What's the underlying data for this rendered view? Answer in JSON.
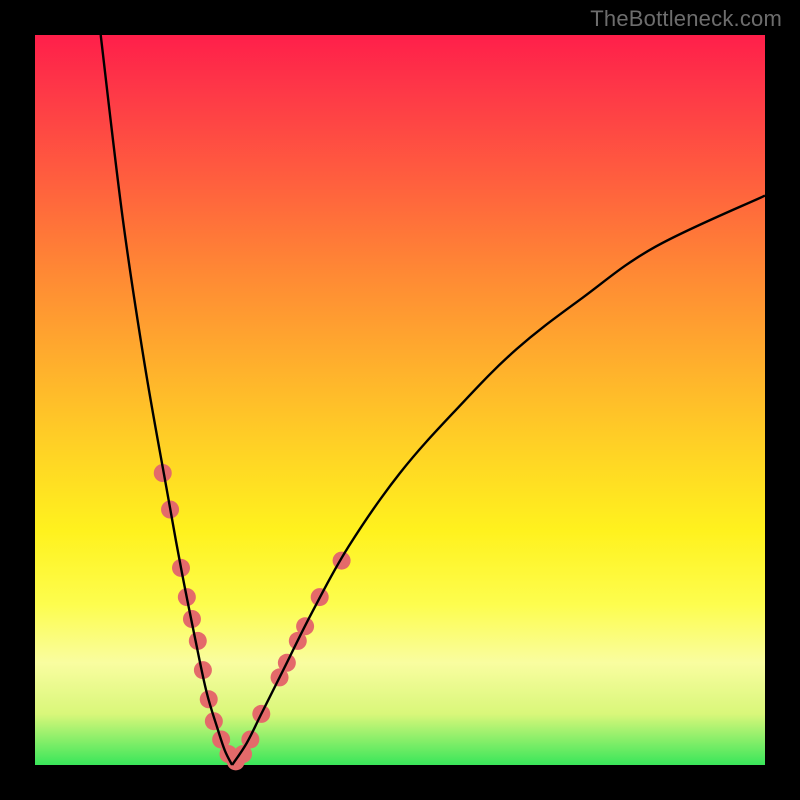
{
  "watermark": "TheBottleneck.com",
  "colors": {
    "frame": "#000000",
    "curve": "#000000",
    "dot_fill": "#e46a6a",
    "dot_stroke": "#c94f4f",
    "gradient_top": "#ff1f4a",
    "gradient_bottom": "#39e65a"
  },
  "chart_data": {
    "type": "line",
    "title": "",
    "xlabel": "",
    "ylabel": "",
    "xlim": [
      0,
      100
    ],
    "ylim": [
      0,
      100
    ],
    "description": "V-shaped bottleneck curve on red-to-green heat gradient. Minimum (0% bottleneck) near x≈27. Left branch rises very steeply to 100% at x≈9; right branch rises more gradually toward ~78% at x=100. Salmon dots cluster near the minimum on both branches.",
    "series": [
      {
        "name": "left-branch",
        "x": [
          9.0,
          12.0,
          15.0,
          18.0,
          20.0,
          22.0,
          23.5,
          25.0,
          26.0,
          27.0
        ],
        "values": [
          100,
          75,
          55,
          38,
          27,
          17,
          10,
          5,
          2,
          0
        ]
      },
      {
        "name": "right-branch",
        "x": [
          27.0,
          29.0,
          31.0,
          34.0,
          38.0,
          43.0,
          50.0,
          58.0,
          66.0,
          75.0,
          85.0,
          100.0
        ],
        "values": [
          0,
          3,
          7,
          13,
          21,
          30,
          40,
          49,
          57,
          64,
          71,
          78
        ]
      }
    ],
    "dots": [
      {
        "x": 17.5,
        "y": 40
      },
      {
        "x": 18.5,
        "y": 35
      },
      {
        "x": 20.0,
        "y": 27
      },
      {
        "x": 20.8,
        "y": 23
      },
      {
        "x": 21.5,
        "y": 20
      },
      {
        "x": 22.3,
        "y": 17
      },
      {
        "x": 23.0,
        "y": 13
      },
      {
        "x": 23.8,
        "y": 9
      },
      {
        "x": 24.5,
        "y": 6
      },
      {
        "x": 25.5,
        "y": 3.5
      },
      {
        "x": 26.5,
        "y": 1.5
      },
      {
        "x": 27.5,
        "y": 0.5
      },
      {
        "x": 28.5,
        "y": 1.5
      },
      {
        "x": 29.5,
        "y": 3.5
      },
      {
        "x": 31.0,
        "y": 7
      },
      {
        "x": 33.5,
        "y": 12
      },
      {
        "x": 34.5,
        "y": 14
      },
      {
        "x": 36.0,
        "y": 17
      },
      {
        "x": 37.0,
        "y": 19
      },
      {
        "x": 39.0,
        "y": 23
      },
      {
        "x": 42.0,
        "y": 28
      }
    ]
  }
}
